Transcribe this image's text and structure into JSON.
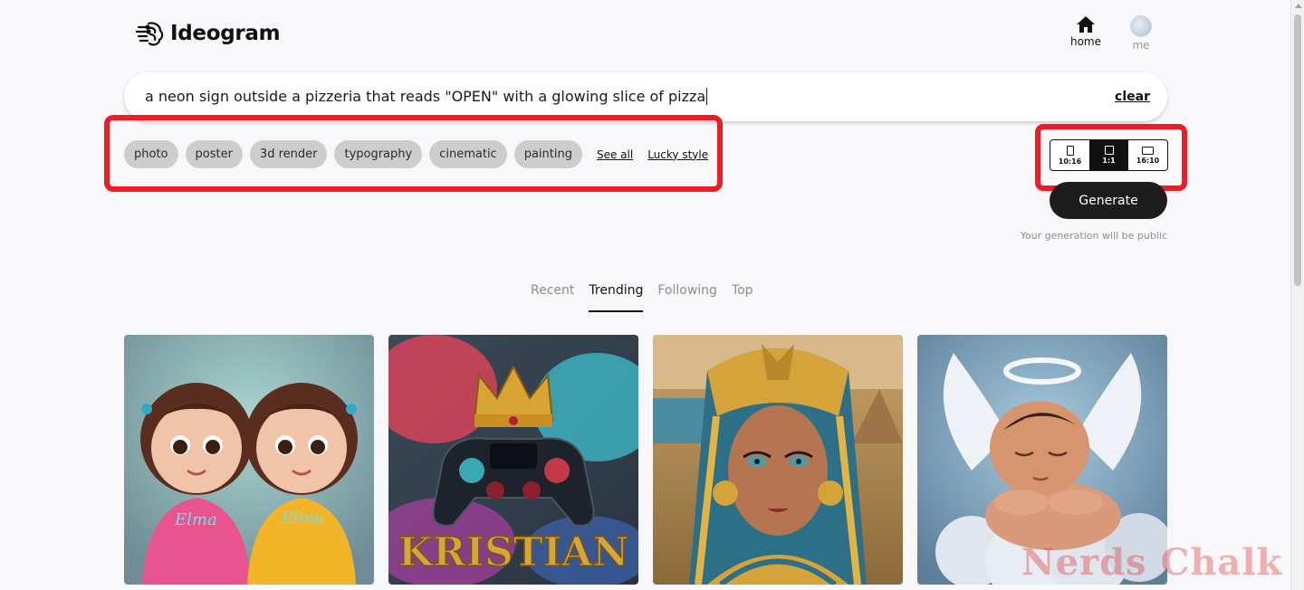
{
  "header": {
    "brand": "Ideogram",
    "nav": {
      "home_label": "home",
      "me_label": "me"
    }
  },
  "prompt": {
    "value": "a neon sign outside a pizzeria that reads \"OPEN\" with a glowing slice of pizza",
    "clear_label": "clear"
  },
  "styles": {
    "chips": [
      "photo",
      "poster",
      "3d render",
      "typography",
      "cinematic",
      "painting"
    ],
    "see_all_label": "See all",
    "lucky_label": "Lucky style"
  },
  "aspect": {
    "options": [
      "10:16",
      "1:1",
      "16:10"
    ],
    "selected": "1:1"
  },
  "generate": {
    "label": "Generate",
    "note": "Your generation will be public"
  },
  "tabs": [
    "Recent",
    "Trending",
    "Following",
    "Top"
  ],
  "active_tab": "Trending",
  "gallery": [
    {
      "title": "two girls in hoodies",
      "caption": "Elma"
    },
    {
      "title": "crown on game controller",
      "caption": "KRISTIAN"
    },
    {
      "title": "egyptian queen",
      "caption": ""
    },
    {
      "title": "baby angel on clouds",
      "caption": ""
    }
  ],
  "watermark": "Nerds Chalk",
  "colors": {
    "highlight": "#ee1c24",
    "primary": "#1d1d1d",
    "chip": "#cdcdcd"
  }
}
